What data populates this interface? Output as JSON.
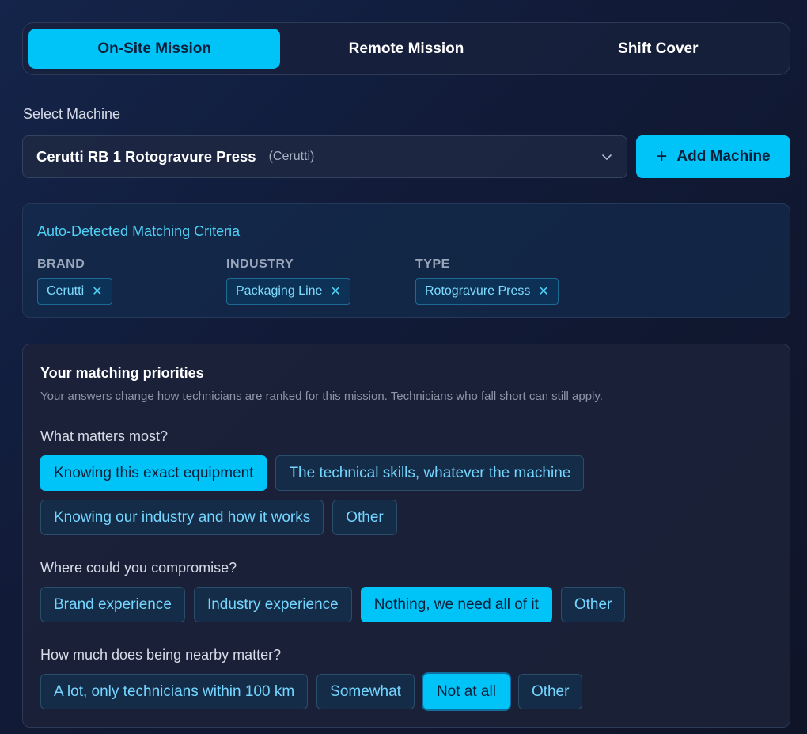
{
  "tabs": [
    {
      "label": "On-Site Mission",
      "active": true
    },
    {
      "label": "Remote Mission",
      "active": false
    },
    {
      "label": "Shift Cover",
      "active": false
    }
  ],
  "machine": {
    "label": "Select Machine",
    "selected_name": "Cerutti RB 1 Rotogravure Press",
    "selected_brand": "(Cerutti)",
    "add_label": "Add Machine"
  },
  "criteria": {
    "title": "Auto-Detected Matching Criteria",
    "brand": {
      "label": "BRAND",
      "value": "Cerutti"
    },
    "industry": {
      "label": "INDUSTRY",
      "value": "Packaging Line"
    },
    "type": {
      "label": "TYPE",
      "value": "Rotogravure Press"
    }
  },
  "priorities": {
    "title": "Your matching priorities",
    "subtitle": "Your answers change how technicians are ranked for this mission. Technicians who fall short can still apply.",
    "questions": [
      {
        "question": "What matters most?",
        "options": [
          "Knowing this exact equipment",
          "The technical skills, whatever the machine",
          "Knowing our industry and how it works",
          "Other"
        ],
        "selected": "Knowing this exact equipment"
      },
      {
        "question": "Where could you compromise?",
        "options": [
          "Brand experience",
          "Industry experience",
          "Nothing, we need all of it",
          "Other"
        ],
        "selected": "Nothing, we need all of it"
      },
      {
        "question": "How much does being nearby matter?",
        "options": [
          "A lot, only technicians within 100 km",
          "Somewhat",
          "Not at all",
          "Other"
        ],
        "selected": "Not at all"
      }
    ]
  },
  "colors": {
    "accent": "#00c3f7",
    "accent_text": "#74d6ff",
    "background": "#111a36"
  }
}
